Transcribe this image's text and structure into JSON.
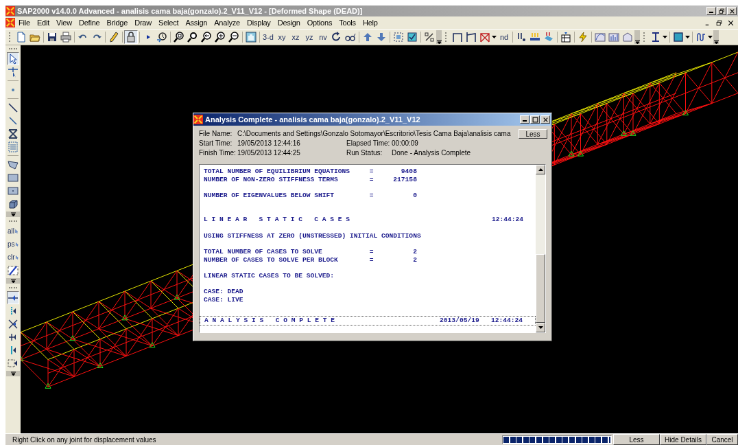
{
  "window": {
    "title": "SAP2000 v14.0.0 Advanced  - analisis cama baja(gonzalo).2_V11_V12 - [Deformed Shape (DEAD)]"
  },
  "menu": [
    "File",
    "Edit",
    "View",
    "Define",
    "Bridge",
    "Draw",
    "Select",
    "Assign",
    "Analyze",
    "Display",
    "Design",
    "Options",
    "Tools",
    "Help"
  ],
  "toolbar": [
    {
      "kind": "grip"
    },
    {
      "kind": "icon"
    },
    {
      "kind": "icon"
    },
    {
      "kind": "sep"
    },
    {
      "kind": "icon"
    },
    {
      "kind": "icon"
    },
    {
      "kind": "sep"
    },
    {
      "kind": "icon"
    },
    {
      "kind": "icon"
    },
    {
      "kind": "sep"
    },
    {
      "kind": "icon"
    },
    {
      "kind": "sep"
    },
    {
      "kind": "icon",
      "pressed": true
    },
    {
      "kind": "sep"
    },
    {
      "kind": "icon"
    },
    {
      "kind": "icon"
    },
    {
      "kind": "sep"
    },
    {
      "kind": "icon"
    },
    {
      "kind": "icon"
    },
    {
      "kind": "icon"
    },
    {
      "kind": "icon"
    },
    {
      "kind": "icon"
    },
    {
      "kind": "sep"
    },
    {
      "kind": "icon"
    },
    {
      "kind": "sep"
    },
    {
      "kind": "text",
      "label": "3-d"
    },
    {
      "kind": "text",
      "label": "xy"
    },
    {
      "kind": "text",
      "label": "xz"
    },
    {
      "kind": "text",
      "label": "yz"
    },
    {
      "kind": "text",
      "label": "nv"
    },
    {
      "kind": "icon"
    },
    {
      "kind": "icon"
    },
    {
      "kind": "sep"
    },
    {
      "kind": "icon"
    },
    {
      "kind": "icon"
    },
    {
      "kind": "sep"
    },
    {
      "kind": "icon"
    },
    {
      "kind": "icon"
    },
    {
      "kind": "sep"
    },
    {
      "kind": "icon"
    },
    {
      "kind": "more"
    },
    {
      "kind": "grip"
    },
    {
      "kind": "icon"
    },
    {
      "kind": "icon"
    },
    {
      "kind": "icon"
    },
    {
      "kind": "caret"
    },
    {
      "kind": "text",
      "label": "nd"
    },
    {
      "kind": "sep"
    },
    {
      "kind": "icon"
    },
    {
      "kind": "icon"
    },
    {
      "kind": "icon"
    },
    {
      "kind": "sep"
    },
    {
      "kind": "icon"
    },
    {
      "kind": "sep"
    },
    {
      "kind": "icon"
    },
    {
      "kind": "sep"
    },
    {
      "kind": "icon"
    },
    {
      "kind": "icon"
    },
    {
      "kind": "icon"
    },
    {
      "kind": "more"
    },
    {
      "kind": "grip"
    },
    {
      "kind": "icon"
    },
    {
      "kind": "caret"
    },
    {
      "kind": "sep"
    },
    {
      "kind": "icon"
    },
    {
      "kind": "caret"
    },
    {
      "kind": "sep"
    },
    {
      "kind": "icon"
    },
    {
      "kind": "caret"
    },
    {
      "kind": "more"
    }
  ],
  "side_toolbar": [
    {
      "kind": "grip"
    },
    {
      "kind": "icon",
      "pressed": true
    },
    {
      "kind": "icon"
    },
    {
      "kind": "sep"
    },
    {
      "kind": "icon"
    },
    {
      "kind": "sep"
    },
    {
      "kind": "icon"
    },
    {
      "kind": "icon"
    },
    {
      "kind": "icon"
    },
    {
      "kind": "icon"
    },
    {
      "kind": "sep"
    },
    {
      "kind": "icon"
    },
    {
      "kind": "icon"
    },
    {
      "kind": "icon"
    },
    {
      "kind": "icon"
    },
    {
      "kind": "more"
    },
    {
      "kind": "grip"
    },
    {
      "kind": "text",
      "label": "all"
    },
    {
      "kind": "text",
      "label": "ps"
    },
    {
      "kind": "text",
      "label": "clr"
    },
    {
      "kind": "icon"
    },
    {
      "kind": "more"
    },
    {
      "kind": "grip"
    },
    {
      "kind": "icon",
      "pressed": true
    },
    {
      "kind": "icon"
    },
    {
      "kind": "icon"
    },
    {
      "kind": "icon"
    },
    {
      "kind": "icon"
    },
    {
      "kind": "icon"
    },
    {
      "kind": "more"
    }
  ],
  "dialog": {
    "title": "Analysis Complete - analisis cama baja(gonzalo).2_V11_V12",
    "file_name": {
      "label": "File Name:",
      "value": "C:\\Documents and Settings\\Gonzalo Sotomayor\\Escritorio\\Tesis Cama Baja\\analisis cama"
    },
    "fields": [
      {
        "label": "Start Time:",
        "value": "19/05/2013 12:44:16"
      },
      {
        "label": "Elapsed Time:",
        "value": "00:00:09"
      },
      {
        "label": "Finish Time:",
        "value": "19/05/2013  12:44:25"
      },
      {
        "label": "Run Status:",
        "value": "Done - Analysis Complete"
      }
    ],
    "less_button": "Less",
    "log": [
      {
        "kind": "line",
        "text": "TOTAL NUMBER OF EQUILIBRIUM EQUATIONS     =       9408"
      },
      {
        "kind": "line",
        "text": "NUMBER OF NON-ZERO STIFFNESS TERMS        =     217158"
      },
      {
        "kind": "blank"
      },
      {
        "kind": "line",
        "text": "NUMBER OF EIGENVALUES BELOW SHIFT         =          0"
      },
      {
        "kind": "blank"
      },
      {
        "kind": "blank"
      },
      {
        "kind": "line",
        "text": "L I N E A R   S T A T I C   C A S E S",
        "right": "12:44:24"
      },
      {
        "kind": "blank"
      },
      {
        "kind": "line",
        "text": "USING STIFFNESS AT ZERO (UNSTRESSED) INITIAL CONDITIONS"
      },
      {
        "kind": "blank"
      },
      {
        "kind": "line",
        "text": "TOTAL NUMBER OF CASES TO SOLVE            =          2"
      },
      {
        "kind": "line",
        "text": "NUMBER OF CASES TO SOLVE PER BLOCK        =          2"
      },
      {
        "kind": "blank"
      },
      {
        "kind": "line",
        "text": "LINEAR STATIC CASES TO BE SOLVED:"
      },
      {
        "kind": "blank"
      },
      {
        "kind": "line",
        "text": "CASE: DEAD"
      },
      {
        "kind": "line",
        "text": "CASE: LIVE"
      },
      {
        "kind": "blank"
      },
      {
        "kind": "banner",
        "text": "A N A L Y S I S   C O M P L E T E",
        "right": "2013/05/19   12:44:24"
      }
    ]
  },
  "status_bar": {
    "text": "Right Click on any joint for displacement values",
    "progress": {
      "level": 1
    },
    "buttons": [
      "Less",
      "Hide Details",
      "Cancel"
    ]
  }
}
